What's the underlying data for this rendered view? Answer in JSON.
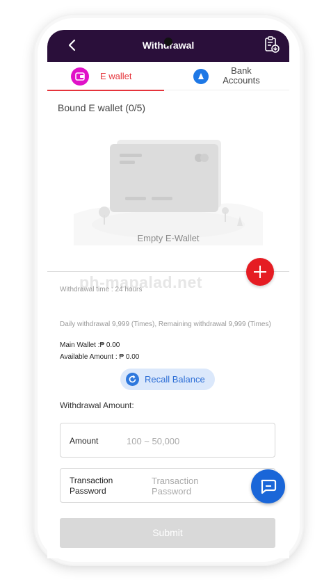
{
  "header": {
    "title": "Withdrawal"
  },
  "tabs": [
    {
      "label": "E wallet",
      "active": true,
      "icon": "wallet-icon"
    },
    {
      "label": "Bank Accounts",
      "active": false,
      "icon": "bank-icon"
    }
  ],
  "ewallet": {
    "section_title": "Bound E wallet (0/5)",
    "empty_text": "Empty E-Wallet"
  },
  "watermark": "ph-mapalad.net",
  "info": {
    "withdraw_time": "Withdrawal time :   24 hours",
    "daily_limit": "Daily withdrawal 9,999 (Times), Remaining withdrawal 9,999 (Times)",
    "main_wallet": "Main Wallet :₱ 0.00",
    "available_amount": "Available Amount : ₱ 0.00"
  },
  "recall": {
    "label": "Recall Balance"
  },
  "form": {
    "amount_heading": "Withdrawal Amount:",
    "amount_label": "Amount",
    "amount_placeholder": "100 ~ 50,000",
    "password_label": "Transaction Password",
    "password_placeholder": "Transaction Password",
    "submit_label": "Submit"
  },
  "colors": {
    "header_bg": "#2a0f3a",
    "accent_red": "#e5343b",
    "add_button": "#e51c23",
    "ewallet_icon": "#e012c8",
    "bank_icon": "#1e78e6",
    "support_button": "#1a66d8",
    "recall_bg": "#dbe8fb"
  }
}
